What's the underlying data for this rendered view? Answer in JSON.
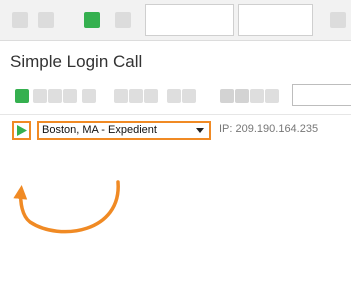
{
  "window": {
    "title": "Simple Login Call"
  },
  "test_row": {
    "location": "Boston, MA - Expedient",
    "ip_label": "IP: 209.190.164.235"
  },
  "icons": {
    "run": "play-icon",
    "dropdown": "chevron-down-icon",
    "annotation": "curved-arrow"
  },
  "colors": {
    "accent": "#f08a24",
    "run_green": "#35b04f"
  }
}
